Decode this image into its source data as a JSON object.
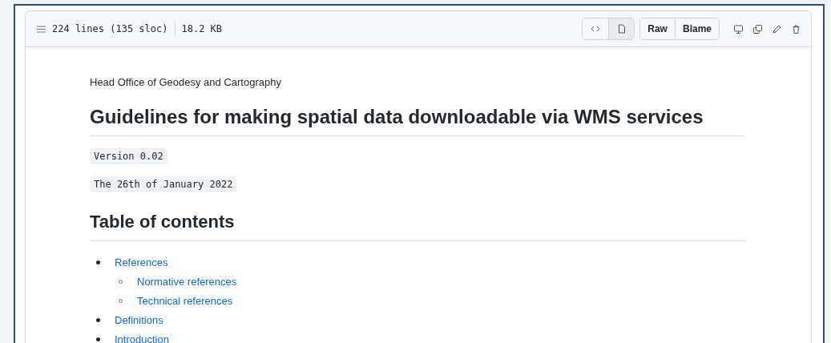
{
  "file_header": {
    "line_info": "224 lines (135 sloc)",
    "size": "18.2 KB",
    "view_toggle": [
      {
        "kind": "code",
        "selected": false
      },
      {
        "kind": "preview",
        "selected": true
      }
    ],
    "buttons": [
      "Raw",
      "Blame"
    ]
  },
  "document": {
    "organization": "Head Office of Geodesy and Cartography",
    "title": "Guidelines for making spatial data downloadable via WMS services",
    "version": "Version 0.02",
    "date": "The 26th of January 2022",
    "toc_heading": "Table of contents",
    "toc": [
      {
        "label": "References",
        "children": [
          {
            "label": "Normative references"
          },
          {
            "label": "Technical references"
          }
        ]
      },
      {
        "label": "Definitions"
      },
      {
        "label": "Introduction"
      }
    ]
  }
}
